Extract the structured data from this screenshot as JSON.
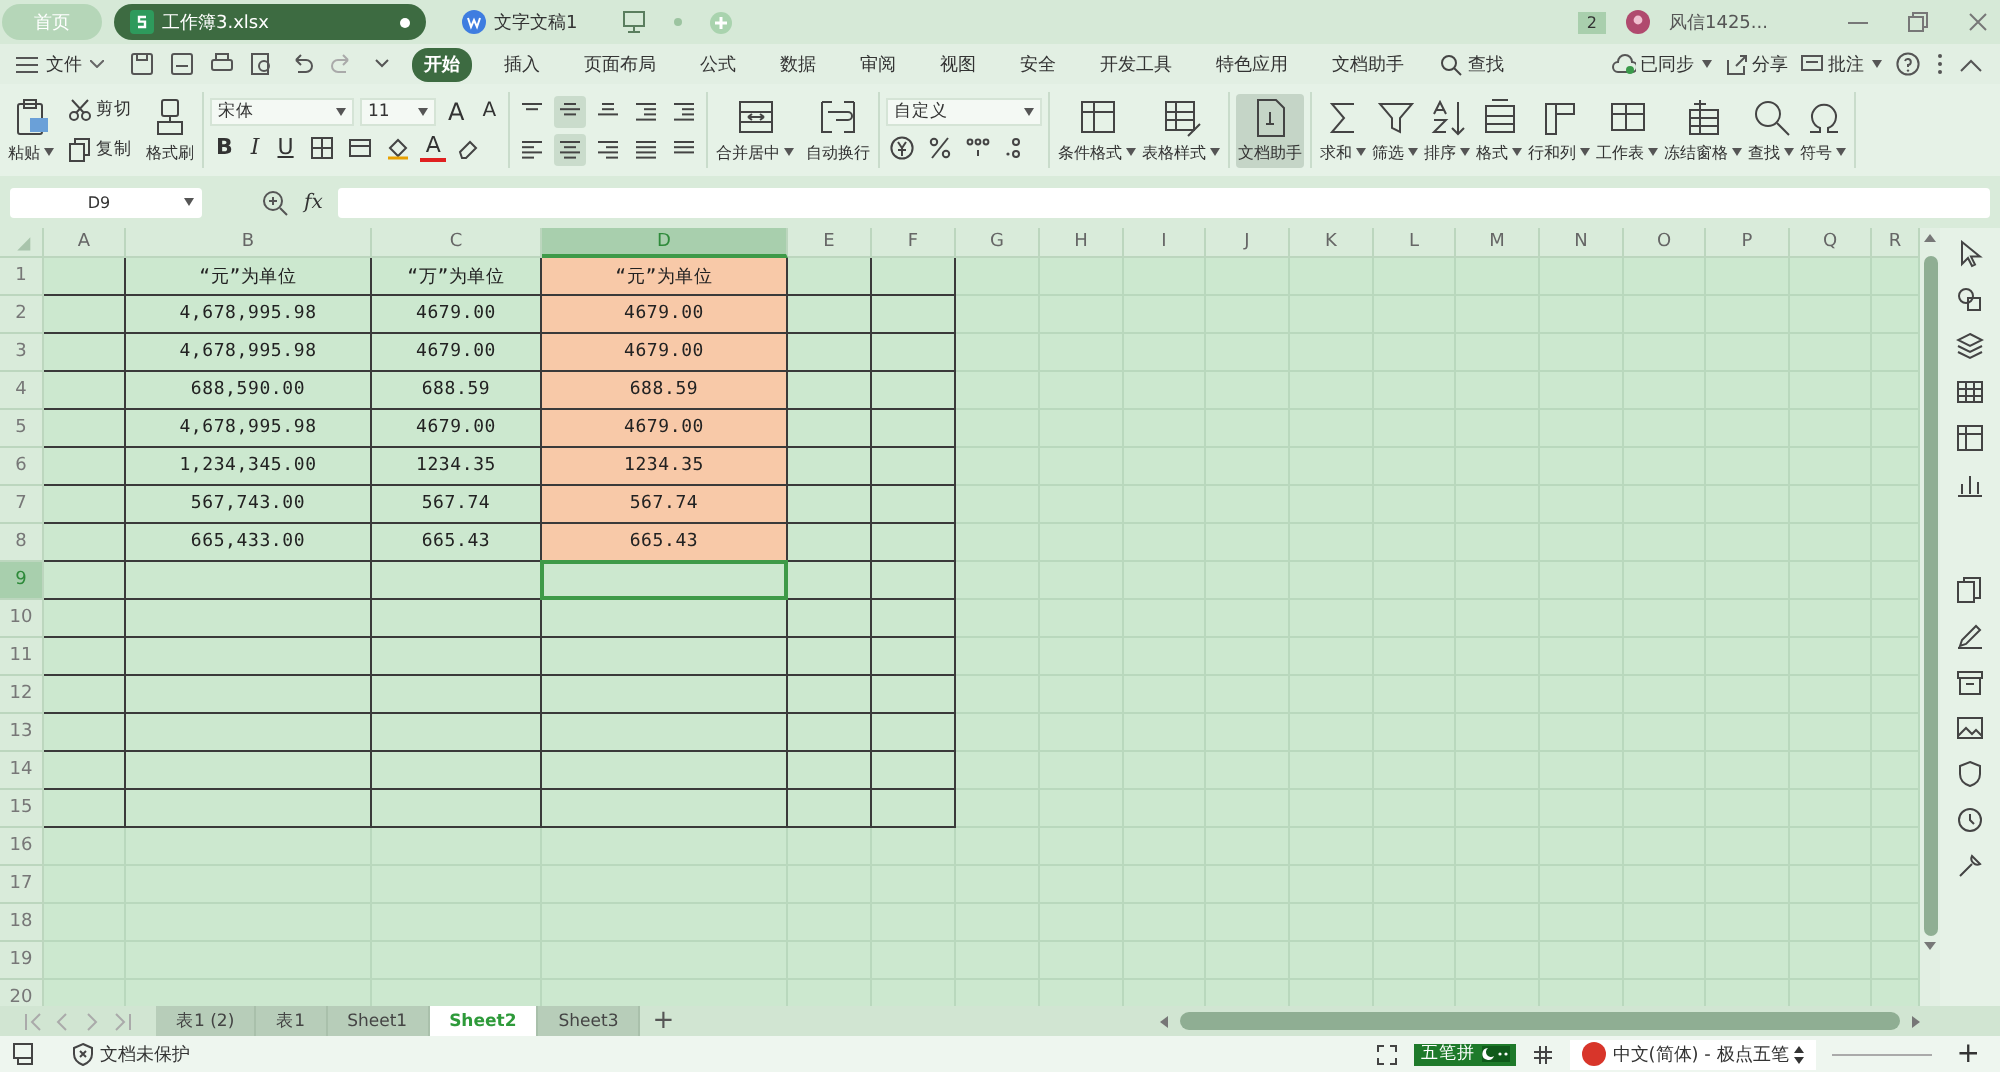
{
  "tabs": [
    {
      "label": "首页",
      "kind": "home",
      "selected": false
    },
    {
      "label": "工作簿3.xlsx",
      "kind": "sheet",
      "selected": true,
      "unsaved": true
    },
    {
      "label": "文字文稿1",
      "kind": "doc",
      "selected": false
    }
  ],
  "account": {
    "badge": "2",
    "name": "风信1425..."
  },
  "menu": {
    "file": "文件",
    "tabs": [
      {
        "label": "开始",
        "selected": true
      },
      {
        "label": "插入",
        "selected": false
      },
      {
        "label": "页面布局",
        "selected": false
      },
      {
        "label": "公式",
        "selected": false
      },
      {
        "label": "数据",
        "selected": false
      },
      {
        "label": "审阅",
        "selected": false
      },
      {
        "label": "视图",
        "selected": false
      },
      {
        "label": "安全",
        "selected": false
      },
      {
        "label": "开发工具",
        "selected": false
      },
      {
        "label": "特色应用",
        "selected": false
      },
      {
        "label": "文档助手",
        "selected": false
      }
    ],
    "search": "查找",
    "actions": [
      {
        "label": "已同步",
        "dropdown": true
      },
      {
        "label": "分享",
        "dropdown": false
      },
      {
        "label": "批注",
        "dropdown": true
      }
    ]
  },
  "ribbon": {
    "paste": "粘贴",
    "cut": "剪切",
    "copy": "复制",
    "format_painter": "格式刷",
    "font": "宋体",
    "size": "11",
    "bold": "B",
    "italic": "I",
    "underline": "U",
    "grow": "A",
    "shrink": "A",
    "font_color": "A",
    "merge": "合并居中",
    "wrap": "自动换行",
    "number_format": "自定义",
    "buttons": [
      {
        "label": "条件格式",
        "dropdown": true,
        "selected": false
      },
      {
        "label": "表格样式",
        "dropdown": true,
        "selected": false
      },
      {
        "label": "文档助手",
        "dropdown": false,
        "selected": true
      },
      {
        "label": "求和",
        "dropdown": true,
        "selected": false
      },
      {
        "label": "筛选",
        "dropdown": true,
        "selected": false
      },
      {
        "label": "排序",
        "dropdown": true,
        "selected": false
      },
      {
        "label": "格式",
        "dropdown": true,
        "selected": false
      },
      {
        "label": "行和列",
        "dropdown": true,
        "selected": false
      },
      {
        "label": "工作表",
        "dropdown": true,
        "selected": false
      },
      {
        "label": "冻结窗格",
        "dropdown": true,
        "selected": false
      },
      {
        "label": "查找",
        "dropdown": true,
        "selected": false
      },
      {
        "label": "符号",
        "dropdown": true,
        "selected": false
      }
    ]
  },
  "formula_bar": {
    "name_box": "D9",
    "fx": "fx"
  },
  "sheet": {
    "columns": [
      {
        "label": "A",
        "selected": false
      },
      {
        "label": "B",
        "selected": false
      },
      {
        "label": "C",
        "selected": false
      },
      {
        "label": "D",
        "selected": true
      },
      {
        "label": "E",
        "selected": false
      },
      {
        "label": "F",
        "selected": false
      },
      {
        "label": "G",
        "selected": false
      },
      {
        "label": "H",
        "selected": false
      },
      {
        "label": "I",
        "selected": false
      },
      {
        "label": "J",
        "selected": false
      },
      {
        "label": "K",
        "selected": false
      },
      {
        "label": "L",
        "selected": false
      },
      {
        "label": "M",
        "selected": false
      },
      {
        "label": "N",
        "selected": false
      },
      {
        "label": "O",
        "selected": false
      },
      {
        "label": "P",
        "selected": false
      },
      {
        "label": "Q",
        "selected": false
      },
      {
        "label": "R",
        "selected": false
      }
    ],
    "rows": [
      {
        "number": "1",
        "selected": false,
        "cells": [
          {
            "kind": "empty"
          },
          {
            "kind": "text",
            "text": "“元”为单位"
          },
          {
            "kind": "text",
            "text": "“万”为单位"
          },
          {
            "kind": "text",
            "text": "“元”为单位",
            "color": "#f8c9a8"
          },
          {
            "kind": "empty"
          },
          {
            "kind": "empty"
          }
        ]
      },
      {
        "number": "2",
        "selected": false,
        "cells": [
          {
            "kind": "empty"
          },
          {
            "kind": "text",
            "text": "4,678,995.98"
          },
          {
            "kind": "text",
            "text": "4679.00"
          },
          {
            "kind": "text",
            "text": "4679.00",
            "color": "#f8c9a8"
          },
          {
            "kind": "empty"
          },
          {
            "kind": "empty"
          }
        ]
      },
      {
        "number": "3",
        "selected": false,
        "cells": [
          {
            "kind": "empty"
          },
          {
            "kind": "text",
            "text": "4,678,995.98"
          },
          {
            "kind": "text",
            "text": "4679.00"
          },
          {
            "kind": "text",
            "text": "4679.00",
            "color": "#f8c9a8"
          },
          {
            "kind": "empty"
          },
          {
            "kind": "empty"
          }
        ]
      },
      {
        "number": "4",
        "selected": false,
        "cells": [
          {
            "kind": "empty"
          },
          {
            "kind": "text",
            "text": "688,590.00"
          },
          {
            "kind": "text",
            "text": "688.59"
          },
          {
            "kind": "text",
            "text": "688.59",
            "color": "#f8c9a8"
          },
          {
            "kind": "empty"
          },
          {
            "kind": "empty"
          }
        ]
      },
      {
        "number": "5",
        "selected": false,
        "cells": [
          {
            "kind": "empty"
          },
          {
            "kind": "text",
            "text": "4,678,995.98"
          },
          {
            "kind": "text",
            "text": "4679.00"
          },
          {
            "kind": "text",
            "text": "4679.00",
            "color": "#f8c9a8"
          },
          {
            "kind": "empty"
          },
          {
            "kind": "empty"
          }
        ]
      },
      {
        "number": "6",
        "selected": false,
        "cells": [
          {
            "kind": "empty"
          },
          {
            "kind": "text",
            "text": "1,234,345.00"
          },
          {
            "kind": "text",
            "text": "1234.35"
          },
          {
            "kind": "text",
            "text": "1234.35",
            "color": "#f8c9a8"
          },
          {
            "kind": "empty"
          },
          {
            "kind": "empty"
          }
        ]
      },
      {
        "number": "7",
        "selected": false,
        "cells": [
          {
            "kind": "empty"
          },
          {
            "kind": "text",
            "text": "567,743.00"
          },
          {
            "kind": "text",
            "text": "567.74"
          },
          {
            "kind": "text",
            "text": "567.74",
            "color": "#f8c9a8"
          },
          {
            "kind": "empty"
          },
          {
            "kind": "empty"
          }
        ]
      },
      {
        "number": "8",
        "selected": false,
        "cells": [
          {
            "kind": "empty"
          },
          {
            "kind": "text",
            "text": "665,433.00"
          },
          {
            "kind": "text",
            "text": "665.43"
          },
          {
            "kind": "text",
            "text": "665.43",
            "color": "#f8c9a8"
          },
          {
            "kind": "empty"
          },
          {
            "kind": "empty"
          }
        ]
      },
      {
        "number": "9",
        "selected": true,
        "cells": [
          {
            "kind": "empty"
          },
          {
            "kind": "empty"
          },
          {
            "kind": "empty"
          },
          {
            "kind": "empty"
          },
          {
            "kind": "empty"
          },
          {
            "kind": "empty"
          }
        ]
      },
      {
        "number": "10",
        "selected": false,
        "cells": [
          {
            "kind": "empty"
          },
          {
            "kind": "empty"
          },
          {
            "kind": "empty"
          },
          {
            "kind": "empty"
          },
          {
            "kind": "empty"
          },
          {
            "kind": "empty"
          }
        ]
      },
      {
        "number": "11",
        "selected": false,
        "cells": [
          {
            "kind": "empty"
          },
          {
            "kind": "empty"
          },
          {
            "kind": "empty"
          },
          {
            "kind": "empty"
          },
          {
            "kind": "empty"
          },
          {
            "kind": "empty"
          }
        ]
      },
      {
        "number": "12",
        "selected": false,
        "cells": [
          {
            "kind": "empty"
          },
          {
            "kind": "empty"
          },
          {
            "kind": "empty"
          },
          {
            "kind": "empty"
          },
          {
            "kind": "empty"
          },
          {
            "kind": "empty"
          }
        ]
      },
      {
        "number": "13",
        "selected": false,
        "cells": [
          {
            "kind": "empty"
          },
          {
            "kind": "empty"
          },
          {
            "kind": "empty"
          },
          {
            "kind": "empty"
          },
          {
            "kind": "empty"
          },
          {
            "kind": "empty"
          }
        ]
      },
      {
        "number": "14",
        "selected": false,
        "cells": [
          {
            "kind": "empty"
          },
          {
            "kind": "empty"
          },
          {
            "kind": "empty"
          },
          {
            "kind": "empty"
          },
          {
            "kind": "empty"
          },
          {
            "kind": "empty"
          }
        ]
      },
      {
        "number": "15",
        "selected": false,
        "cells": [
          {
            "kind": "empty"
          },
          {
            "kind": "empty"
          },
          {
            "kind": "empty"
          },
          {
            "kind": "empty"
          },
          {
            "kind": "empty"
          },
          {
            "kind": "empty"
          }
        ]
      },
      {
        "number": "16",
        "selected": false
      },
      {
        "number": "17",
        "selected": false
      },
      {
        "number": "18",
        "selected": false
      },
      {
        "number": "19",
        "selected": false
      },
      {
        "number": "20",
        "selected": false
      }
    ]
  },
  "sheet_tabs": [
    {
      "label": "表1 (2)",
      "selected": false
    },
    {
      "label": "表1",
      "selected": false
    },
    {
      "label": "Sheet1",
      "selected": false
    },
    {
      "label": "Sheet2",
      "selected": true
    },
    {
      "label": "Sheet3",
      "selected": false
    }
  ],
  "add_sheet": "+",
  "status_bar": {
    "protection": "文档未保护",
    "ime_mode": "五笔拼",
    "ime_language": "中文(简体) - 极点五笔",
    "zoom_in": "+"
  }
}
